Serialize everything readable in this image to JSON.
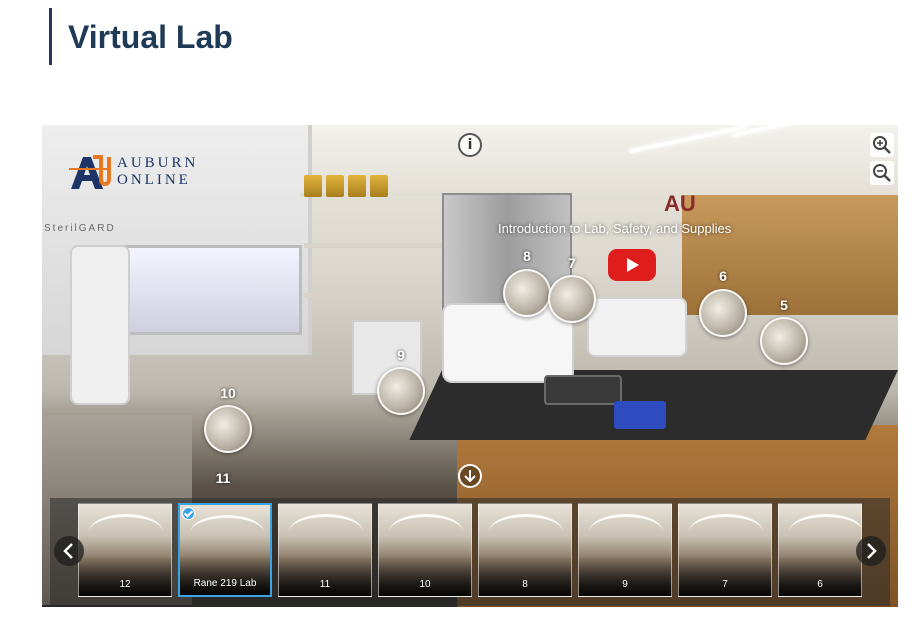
{
  "page": {
    "title": "Virtual Lab"
  },
  "viewer": {
    "logo_line1": "AUBURN",
    "logo_line2": "ONLINE",
    "hood_label": "SterilGARD",
    "video_label": "Introduction to Lab, Safety, and Supplies",
    "info_icon": "i",
    "hotspots": [
      "8",
      "7",
      "6",
      "5",
      "9",
      "10",
      "11"
    ],
    "thumbnails": [
      {
        "label": "12",
        "active": false
      },
      {
        "label": "Rane 219 Lab",
        "active": true
      },
      {
        "label": "11",
        "active": false
      },
      {
        "label": "10",
        "active": false
      },
      {
        "label": "8",
        "active": false
      },
      {
        "label": "9",
        "active": false
      },
      {
        "label": "7",
        "active": false
      },
      {
        "label": "6",
        "active": false
      }
    ]
  },
  "icons": {
    "info": "info-icon",
    "zoom_in": "zoom-in-icon",
    "zoom_out": "zoom-out-icon",
    "play": "youtube-play-icon",
    "down": "arrow-down-icon",
    "prev": "chevron-left-icon",
    "next": "chevron-right-icon"
  },
  "colors": {
    "title": "#1f3a57",
    "accent": "#3aa3e3",
    "youtube": "#e01d1d",
    "brand": "#1c3566"
  }
}
